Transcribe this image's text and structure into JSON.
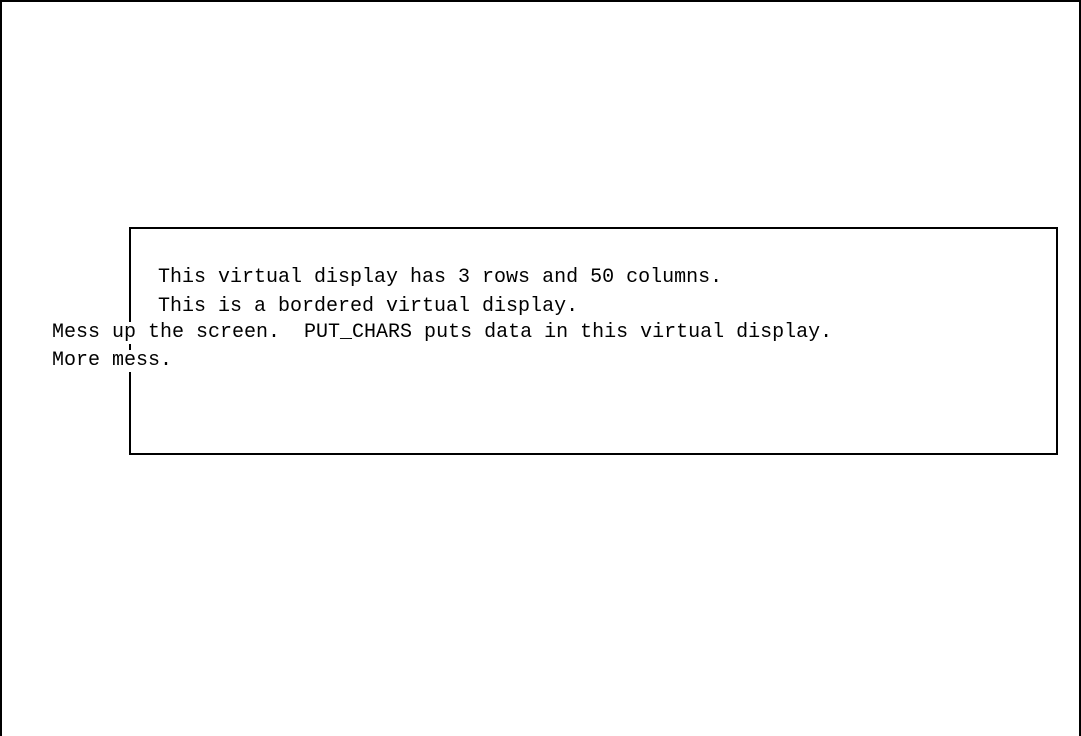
{
  "virtual_display": {
    "line_1": "This virtual display has 3 rows and 50 columns.",
    "line_2": "This is a bordered virtual display."
  },
  "screen_mess": {
    "line_1": "Mess up the screen.  PUT_CHARS puts data in this virtual display.",
    "line_2": "More mess."
  }
}
